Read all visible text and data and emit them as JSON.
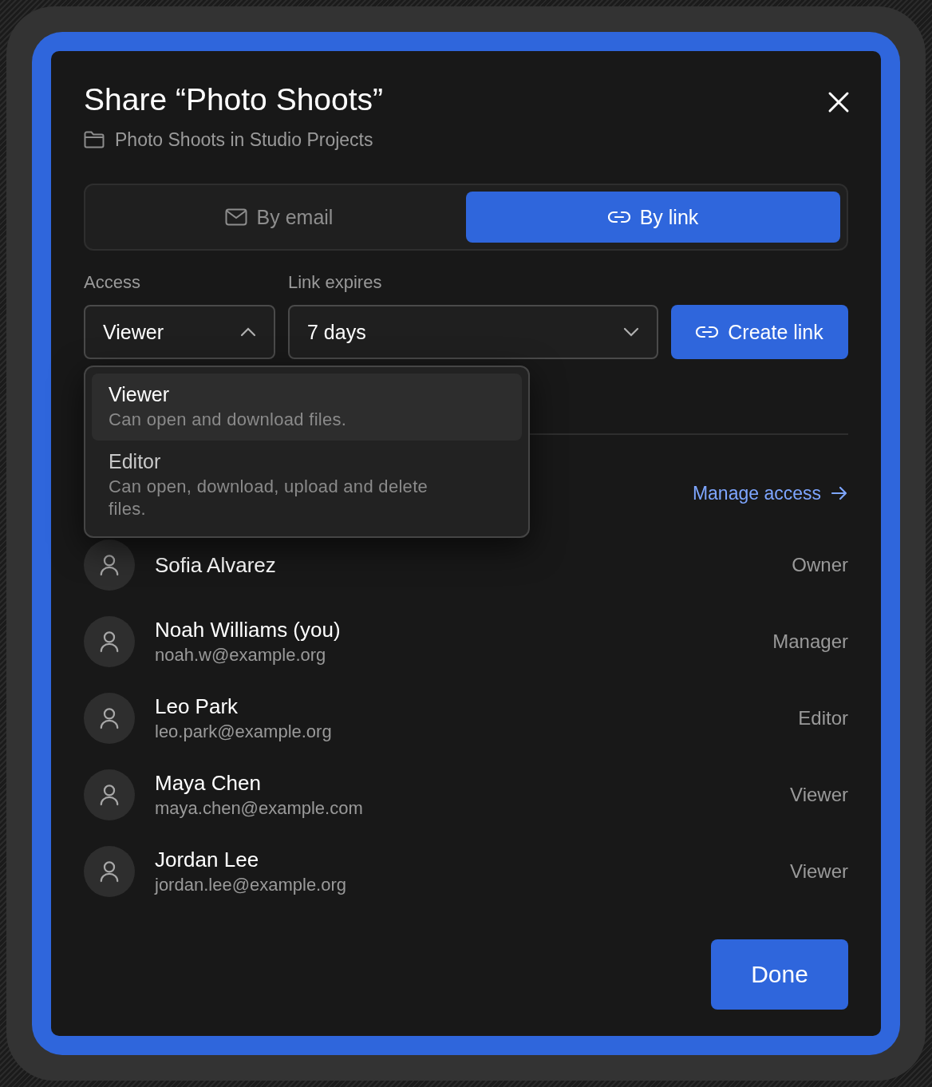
{
  "dialog": {
    "title": "Share “Photo Shoots”",
    "location": "Photo Shoots in Studio Projects",
    "tabs": [
      {
        "label": "By email",
        "selected": false
      },
      {
        "label": "By link",
        "selected": true
      }
    ],
    "access": {
      "label": "Access",
      "value": "Viewer",
      "expanded": true,
      "options": [
        {
          "title": "Viewer",
          "description": "Can open and download files.",
          "selected": true
        },
        {
          "title": "Editor",
          "description": "Can open, download, upload and delete files.",
          "selected": false
        }
      ]
    },
    "expires": {
      "label": "Link expires",
      "value": "7 days",
      "expanded": false
    },
    "create_button": "Create link",
    "manage_link": "Manage access",
    "people": [
      {
        "name": "Sofia Alvarez",
        "role": "Owner"
      },
      {
        "name": "Noah Williams (you)",
        "email": "noah.w@example.org",
        "role": "Manager"
      },
      {
        "name": "Leo Park",
        "email": "leo.park@example.org",
        "role": "Editor"
      },
      {
        "name": "Maya Chen",
        "email": "maya.chen@example.com",
        "role": "Viewer"
      },
      {
        "name": "Jordan Lee",
        "email": "jordan.lee@example.org",
        "role": "Viewer"
      }
    ],
    "done_button": "Done"
  }
}
